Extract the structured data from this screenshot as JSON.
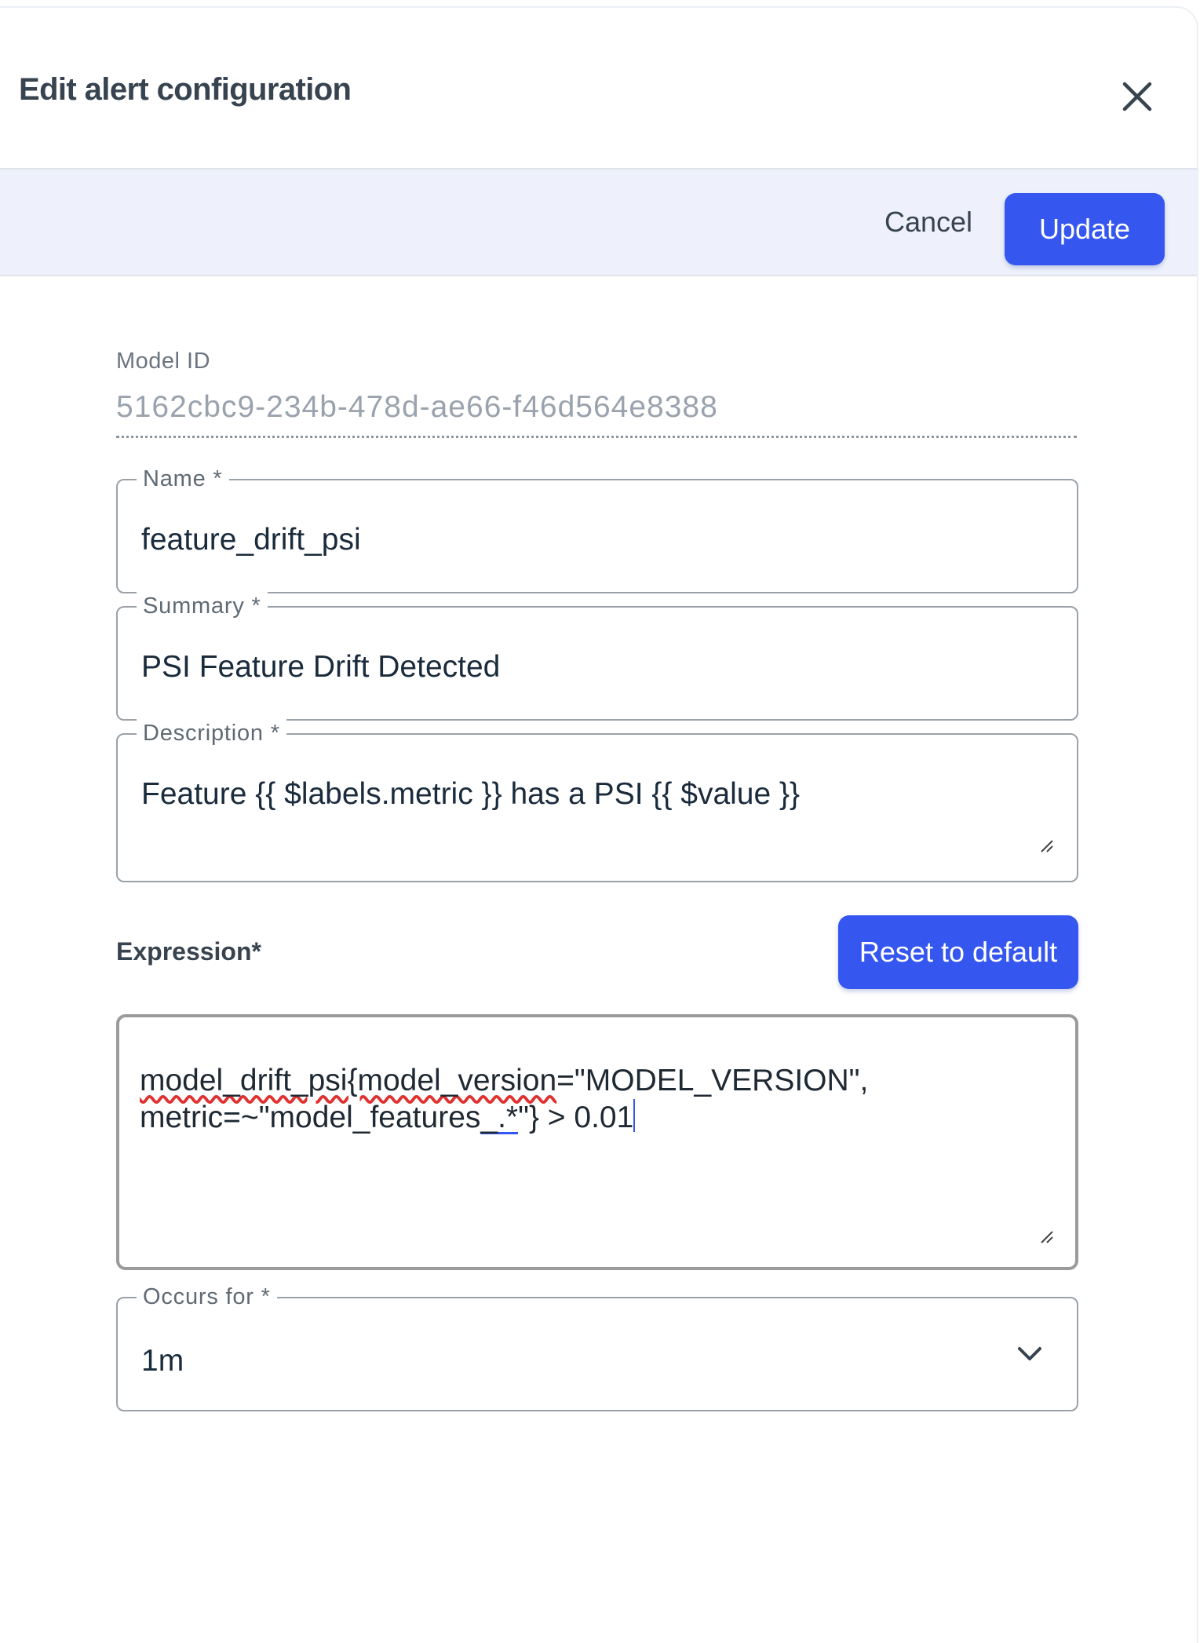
{
  "dialog": {
    "title": "Edit alert configuration"
  },
  "toolbar": {
    "cancel_label": "Cancel",
    "update_label": "Update"
  },
  "form": {
    "model_id": {
      "label": "Model ID",
      "value": "5162cbc9-234b-478d-ae66-f46d564e8388"
    },
    "name": {
      "label": "Name *",
      "value": "feature_drift_psi"
    },
    "summary": {
      "label": "Summary *",
      "value": "PSI Feature Drift Detected"
    },
    "description": {
      "label": "Description *",
      "value": "Feature {{ $labels.metric }} has a PSI {{ $value }}"
    },
    "expression": {
      "label": "Expression*",
      "reset_label": "Reset to default",
      "parts": {
        "p1": "model_drift_psi{model_version",
        "p2": "=\"MODEL_VERSION\",",
        "p3": "metric=~\"model_features",
        "p4": "_.*",
        "p5": "\"} > 0.01"
      }
    },
    "occurs_for": {
      "label": "Occurs for *",
      "value": "1m"
    }
  },
  "colors": {
    "primary": "#3557f0",
    "toolbar_bg": "#eef1fc",
    "spell_error": "#e03131"
  },
  "icons": {
    "close": "close-icon",
    "resize": "resize-grip-icon",
    "dropdown": "chevron-down-icon"
  }
}
